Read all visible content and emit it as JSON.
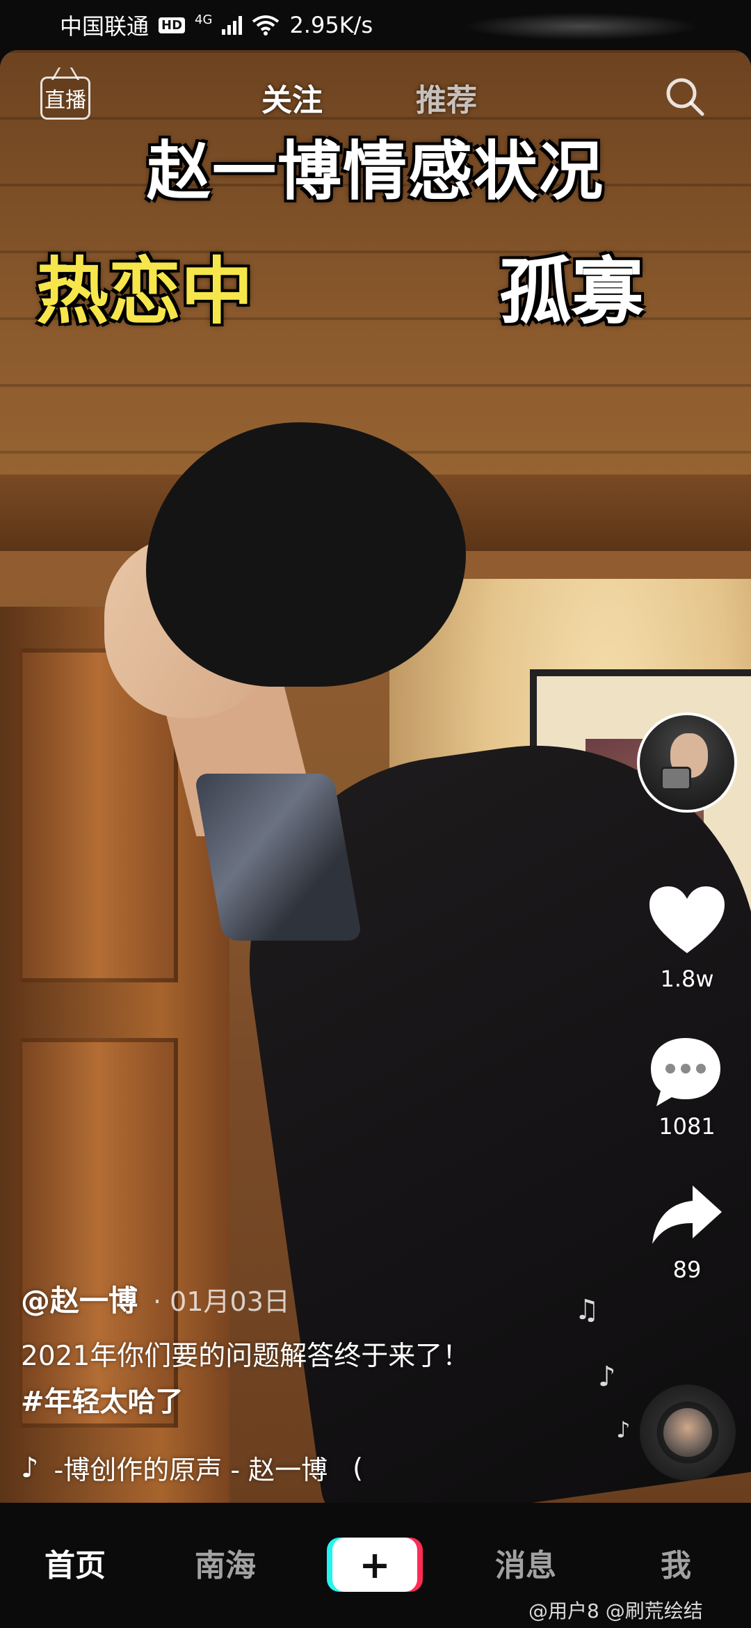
{
  "status_bar": {
    "carrier": "中国联通",
    "hd_badge": "HD",
    "network": "4G",
    "speed": "2.95K/s"
  },
  "top_nav": {
    "live_label": "直播",
    "tabs": [
      {
        "label": "关注",
        "active": true
      },
      {
        "label": "推荐",
        "active": false
      }
    ],
    "search_icon": "search-icon"
  },
  "video_overlay": {
    "title": "赵一博情感状况",
    "left_label": "热恋中",
    "right_label": "孤寡"
  },
  "actions": {
    "like_count": "1.8w",
    "comment_count": "1081",
    "share_count": "89"
  },
  "post": {
    "author": "@赵一博",
    "date": "· 01月03日",
    "caption": "2021年你们要的问题解答终于来了！",
    "hashtag": "#年轻太哈了",
    "music": "-博创作的原声 - 赵一博",
    "music_tail": "("
  },
  "bottom_nav": {
    "items": [
      "首页",
      "南海",
      "消息",
      "我"
    ],
    "plus_label": "+"
  },
  "watermark": "@用户8 @刷荒绘结",
  "colors": {
    "accent_yellow": "#f7e64b",
    "tiktok_cyan": "#25f4ee",
    "tiktok_red": "#fe2c55"
  }
}
